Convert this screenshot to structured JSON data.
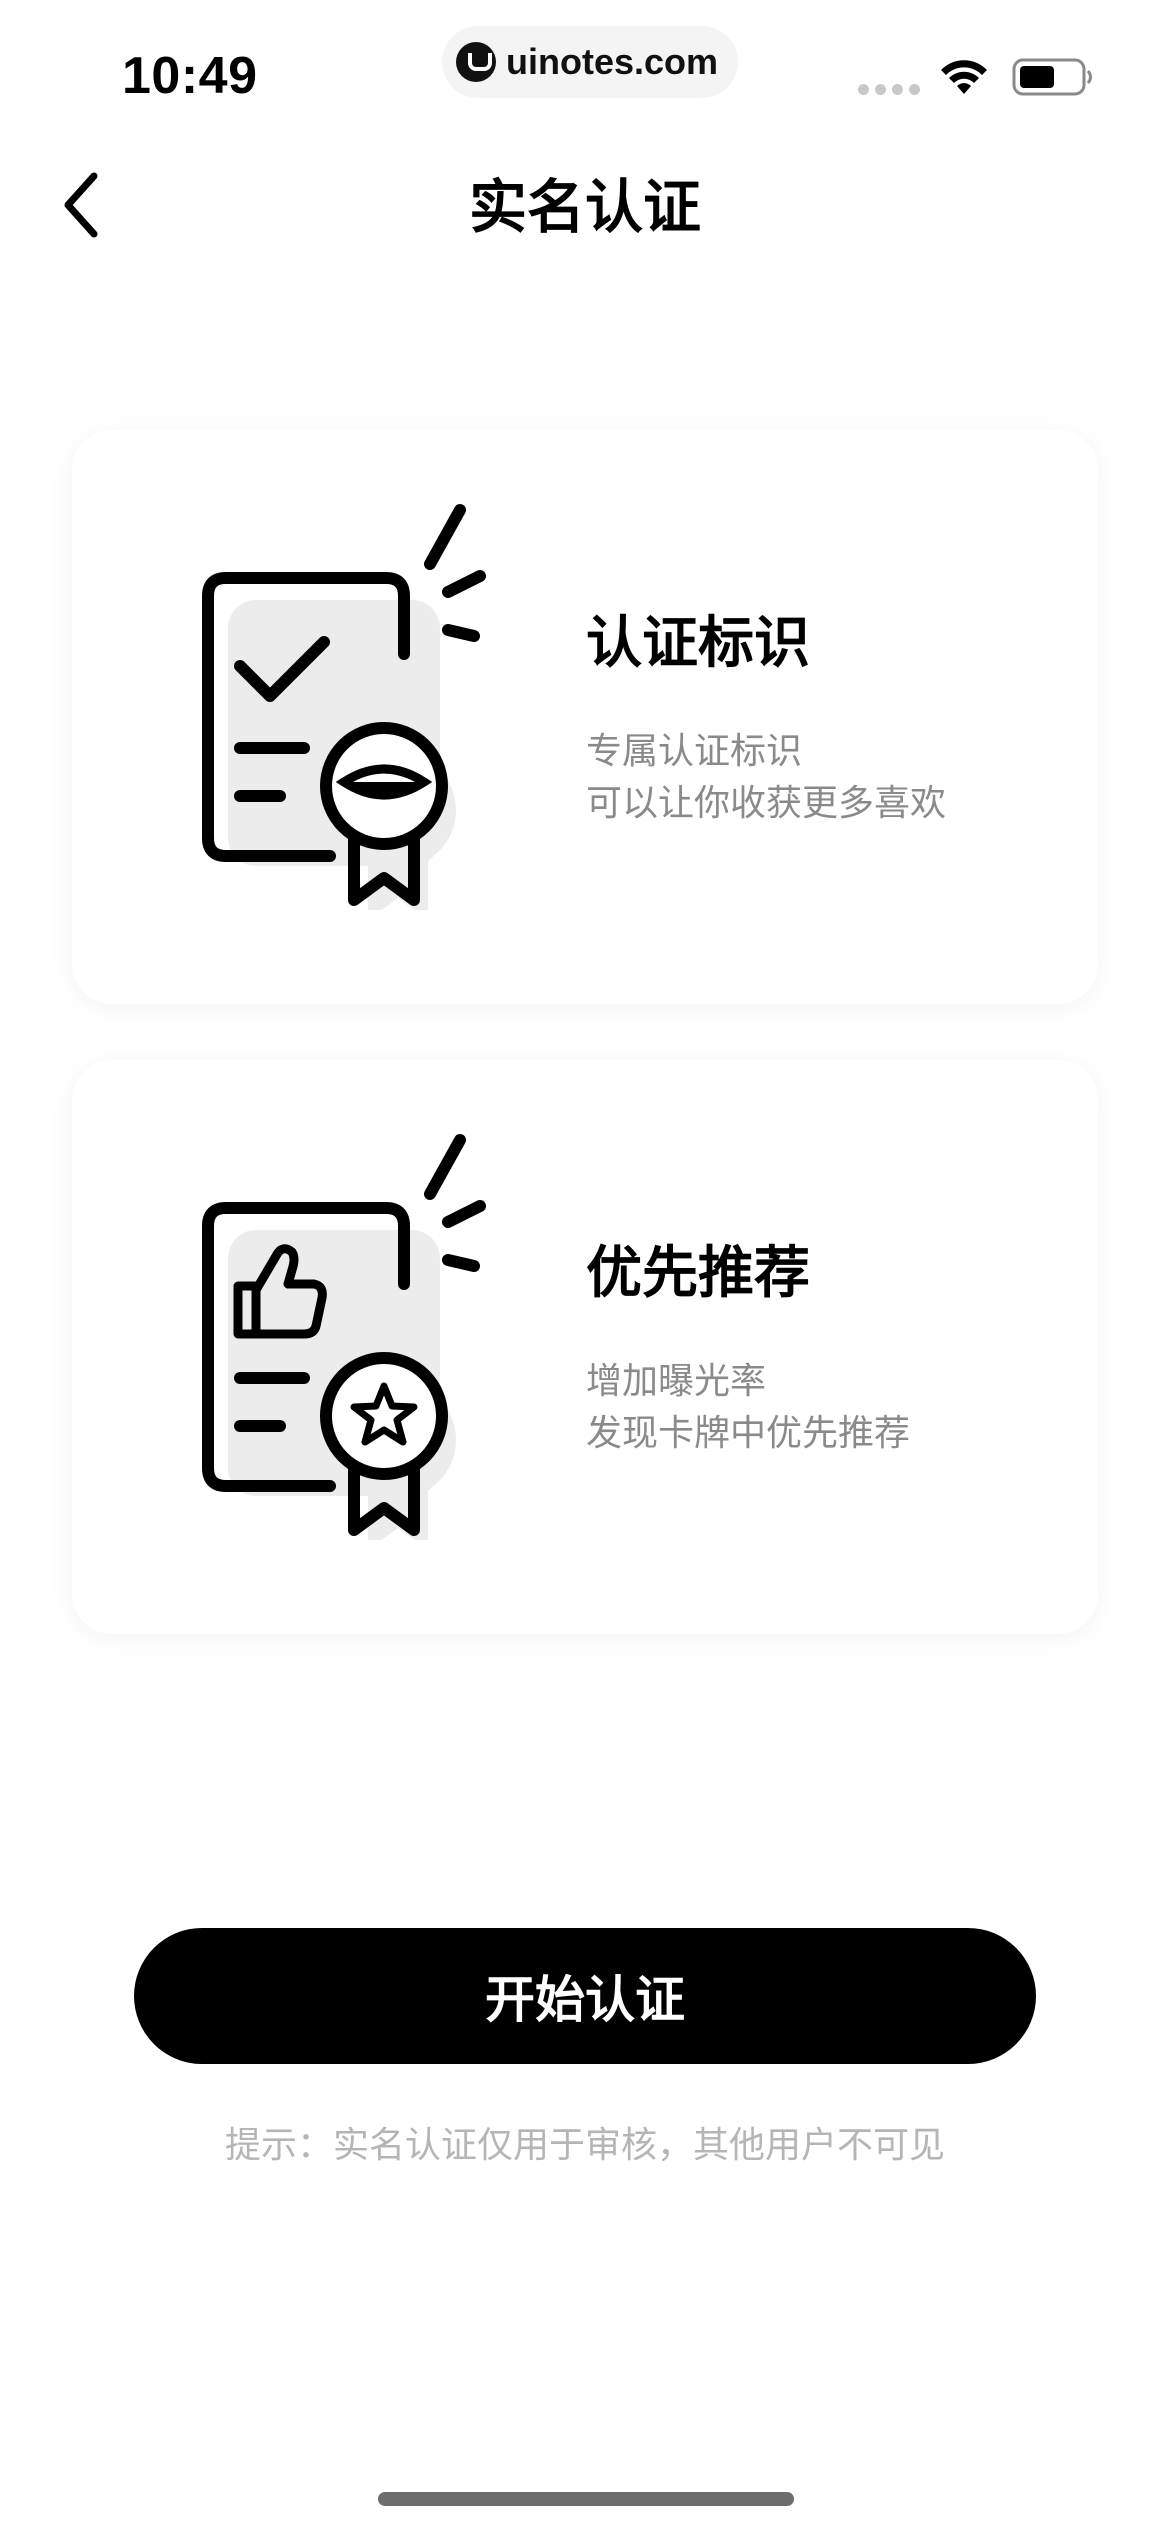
{
  "status_bar": {
    "time": "10:49",
    "url": "uinotes.com"
  },
  "nav": {
    "title": "实名认证"
  },
  "cards": [
    {
      "title": "认证标识",
      "desc_line1": "专属认证标识",
      "desc_line2": "可以让你收获更多喜欢"
    },
    {
      "title": "优先推荐",
      "desc_line1": "增加曝光率",
      "desc_line2": "发现卡牌中优先推荐"
    }
  ],
  "actions": {
    "start_label": "开始认证",
    "tip": "提示：实名认证仅用于审核，其他用户不可见"
  },
  "icons": {
    "back": "chevron-left-icon",
    "wifi": "wifi-icon",
    "battery": "battery-icon",
    "card1": "certificate-check-icon",
    "card2": "certificate-thumbs-up-icon"
  }
}
